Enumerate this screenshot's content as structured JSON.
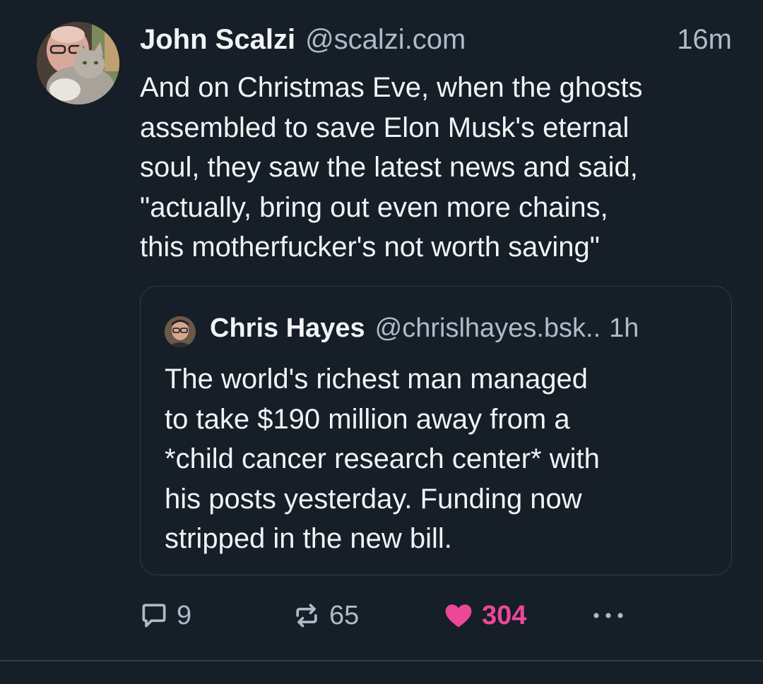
{
  "post": {
    "author": {
      "name": "John Scalzi",
      "handle": "@scalzi.com",
      "avatar_icon": "author-avatar-photo"
    },
    "time": "16m",
    "text": "And on Christmas Eve, when the ghosts\nassembled to save Elon Musk's eternal\nsoul, they saw the latest news and said,\n\"actually, bring out even more chains,\nthis motherfucker's not worth saving\"",
    "quote": {
      "author": {
        "name": "Chris Hayes",
        "handle": "@chrislhayes.bsk..",
        "avatar_icon": "quoted-author-avatar-photo"
      },
      "time": "1h",
      "text": "The world's richest man managed\nto take $190 million away from a\n*child cancer research center* with\nhis posts yesterday. Funding now\nstripped in the new bill."
    },
    "actions": {
      "replies": "9",
      "reposts": "65",
      "likes": "304",
      "reply_icon": "speech-bubble-icon",
      "repost_icon": "repost-arrows-icon",
      "like_icon": "heart-icon",
      "more_icon": "ellipsis-icon"
    }
  },
  "colors": {
    "background": "#161e27",
    "text": "#f1f3f5",
    "muted": "#aebbc9",
    "border": "#2e3d4c",
    "like_active": "#ec4899"
  }
}
